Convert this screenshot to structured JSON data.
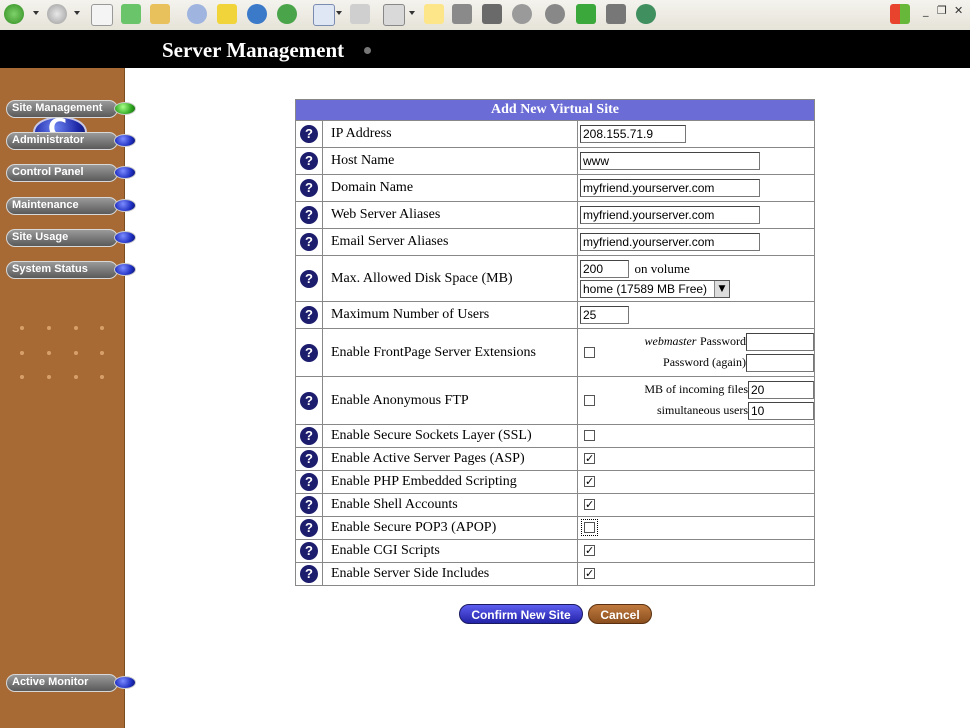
{
  "header": {
    "title": "Server Management"
  },
  "sidebar": {
    "items": [
      {
        "label": "Site Management",
        "active": true
      },
      {
        "label": "Administrator",
        "active": false
      },
      {
        "label": "Control Panel",
        "active": false
      },
      {
        "label": "Maintenance",
        "active": false
      },
      {
        "label": "Site Usage",
        "active": false
      },
      {
        "label": "System Status",
        "active": false
      }
    ],
    "monitor_label": "Active Monitor"
  },
  "form": {
    "title": "Add New Virtual Site",
    "help_glyph": "?",
    "rows": {
      "ip": {
        "label": "IP Address",
        "value": "208.155.71.9"
      },
      "host": {
        "label": "Host Name",
        "value": "www"
      },
      "domain": {
        "label": "Domain Name",
        "value": "myfriend.yourserver.com"
      },
      "web_alias": {
        "label": "Web Server Aliases",
        "value": "myfriend.yourserver.com"
      },
      "email_alias": {
        "label": "Email Server Aliases",
        "value": "myfriend.yourserver.com"
      },
      "disk": {
        "label": "Max. Allowed Disk Space (MB)",
        "value": "200",
        "volume_label": "on volume",
        "volume_selected": "home (17589 MB Free)"
      },
      "max_users": {
        "label": "Maximum Number of Users",
        "value": "25"
      },
      "frontpage": {
        "label": "Enable FrontPage Server Extensions",
        "checked": false,
        "pw_label_em": "webmaster",
        "pw_label": "Password",
        "pw_again_label": "Password (again)"
      },
      "ftp": {
        "label": "Enable Anonymous FTP",
        "checked": false,
        "mb_label": "MB of incoming files",
        "mb_value": "20",
        "users_label": "simultaneous users",
        "users_value": "10"
      },
      "ssl": {
        "label": "Enable Secure Sockets Layer (SSL)",
        "checked": false
      },
      "asp": {
        "label": "Enable Active Server Pages (ASP)",
        "checked": true
      },
      "php": {
        "label": "Enable PHP Embedded Scripting",
        "checked": true
      },
      "shell": {
        "label": "Enable Shell Accounts",
        "checked": true
      },
      "apop": {
        "label": "Enable Secure POP3 (APOP)",
        "checked": false
      },
      "cgi": {
        "label": "Enable CGI Scripts",
        "checked": true
      },
      "ssi": {
        "label": "Enable Server Side Includes",
        "checked": true
      }
    }
  },
  "buttons": {
    "confirm": "Confirm New Site",
    "cancel": "Cancel"
  },
  "glyphs": {
    "checked": "✓",
    "unchecked": ""
  },
  "colors": {
    "sidebar": "#a86a35",
    "form_title": "#6c6cd6",
    "header": "#000000"
  }
}
